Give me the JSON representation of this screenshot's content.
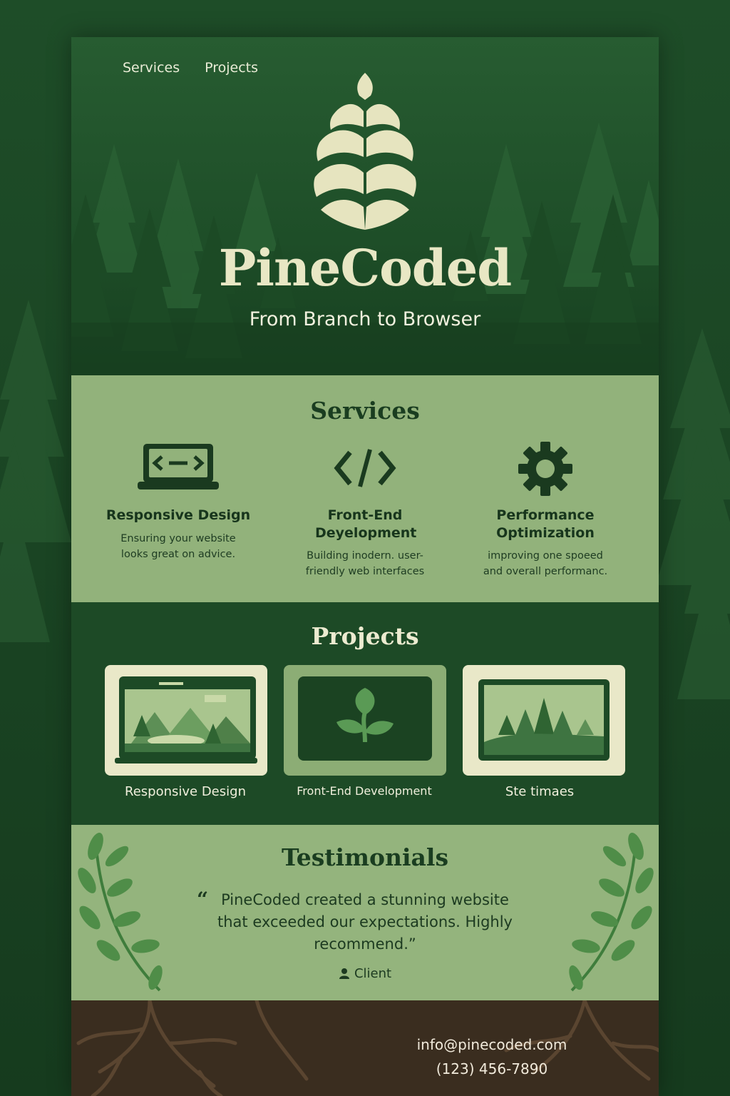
{
  "nav": {
    "items": [
      "Services",
      "Projects"
    ]
  },
  "hero": {
    "brand": "PineCoded",
    "tagline": "From Branch to Browser"
  },
  "services": {
    "title": "Services",
    "items": [
      {
        "icon": "laptop-code-icon",
        "title": "Responsive Design",
        "desc": "Ensuring your website looks great on advice."
      },
      {
        "icon": "code-brackets-icon",
        "title": "Front-End Deyelopment",
        "desc": "Building inodern. user-friendly web interfaces"
      },
      {
        "icon": "gear-icon",
        "title": "Performance Optimization",
        "desc": "improving one spoeed and overall performanc."
      }
    ]
  },
  "projects": {
    "title": "Projects",
    "items": [
      {
        "label": "Responsive Design"
      },
      {
        "label": "Front-End Development"
      },
      {
        "label": "Ste timaes"
      }
    ]
  },
  "testimonials": {
    "title": "Testimonials",
    "quote_mark": "“",
    "quote": "PineCoded created a stunning website that exceeded our expectations. Highly recommend.”",
    "client": "Client"
  },
  "footer": {
    "email": "info@pinecoded.com",
    "phone": "(123) 456-7890"
  },
  "colors": {
    "dark_green": "#1d4a26",
    "light_green": "#92b27b",
    "cream": "#e8e7c4",
    "soil": "#3a2d1f"
  }
}
